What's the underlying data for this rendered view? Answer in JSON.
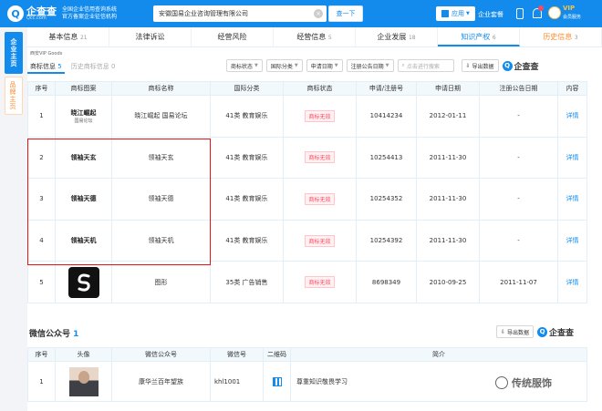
{
  "header": {
    "logo_mark": "Q",
    "logo_name": "企查查",
    "logo_url": "Qcc.com",
    "slogan_line1": "全国企业信用查询系统",
    "slogan_line2": "官方备案企业征信机构",
    "search_value": "安徽国易企业咨询管理有限公司",
    "search_button": "查一下",
    "app_label": "应用",
    "nav_link": "企业套餐",
    "vip_label": "VIP",
    "vip_sub": "会员服务"
  },
  "side_tabs": {
    "company": "企业主页",
    "brand": "品牌主页"
  },
  "tabs": [
    {
      "label": "基本信息",
      "count": "21"
    },
    {
      "label": "法律诉讼",
      "count": ""
    },
    {
      "label": "经营风险",
      "count": ""
    },
    {
      "label": "经营信息",
      "count": "5"
    },
    {
      "label": "企业发展",
      "count": "18"
    },
    {
      "label": "知识产权",
      "count": "6"
    },
    {
      "label": "历史信息",
      "count": "3"
    }
  ],
  "company_line": "西安VIP Goods",
  "subtabs": [
    {
      "label": "商标信息",
      "count": "5"
    },
    {
      "label": "历史商标信息",
      "count": "0"
    }
  ],
  "filters": [
    "商标状态",
    "国际分类",
    "申请日期",
    "注册公告日期"
  ],
  "filter_search_placeholder": "点击进行搜索",
  "export_label": "导出数据",
  "brand_mini": "企查查",
  "trademark_table": {
    "headers": [
      "序号",
      "商标图案",
      "商标名称",
      "国际分类",
      "商标状态",
      "申请/注册号",
      "申请日期",
      "注册公告日期",
      "内容"
    ],
    "rows": [
      {
        "no": "1",
        "image_text": "晓江崛起",
        "image_sub": "国易论坛",
        "name": "晓江崛起 国易论坛",
        "class": "41类 教育娱乐",
        "status": "商标无效",
        "reg_no": "10414234",
        "apply_date": "2012-01-11",
        "pub_date": "-",
        "action": "详情"
      },
      {
        "no": "2",
        "image_text": "领袖天玄",
        "image_sub": "",
        "name": "领袖天玄",
        "class": "41类 教育娱乐",
        "status": "商标无效",
        "reg_no": "10254413",
        "apply_date": "2011-11-30",
        "pub_date": "-",
        "action": "详情"
      },
      {
        "no": "3",
        "image_text": "领袖天德",
        "image_sub": "",
        "name": "领袖天德",
        "class": "41类 教育娱乐",
        "status": "商标无效",
        "reg_no": "10254352",
        "apply_date": "2011-11-30",
        "pub_date": "-",
        "action": "详情"
      },
      {
        "no": "4",
        "image_text": "领袖天机",
        "image_sub": "",
        "name": "领袖天机",
        "class": "41类 教育娱乐",
        "status": "商标无效",
        "reg_no": "10254392",
        "apply_date": "2011-11-30",
        "pub_date": "-",
        "action": "详情"
      },
      {
        "no": "5",
        "image_text": "",
        "image_sub": "",
        "name": "图形",
        "class": "35类 广告销售",
        "status": "商标无效",
        "reg_no": "8698349",
        "apply_date": "2010-09-25",
        "pub_date": "2011-11-07",
        "action": "详情"
      }
    ]
  },
  "wechat": {
    "title": "微信公众号",
    "count": "1",
    "headers": [
      "序号",
      "头像",
      "微信公众号",
      "微信号",
      "二维码",
      "简介"
    ],
    "rows": [
      {
        "no": "1",
        "account": "康华兰百年望族",
        "wechat_id": "khl1001",
        "intro": "尊重知识敬畏学习"
      }
    ]
  },
  "watermark": "传统服饰"
}
